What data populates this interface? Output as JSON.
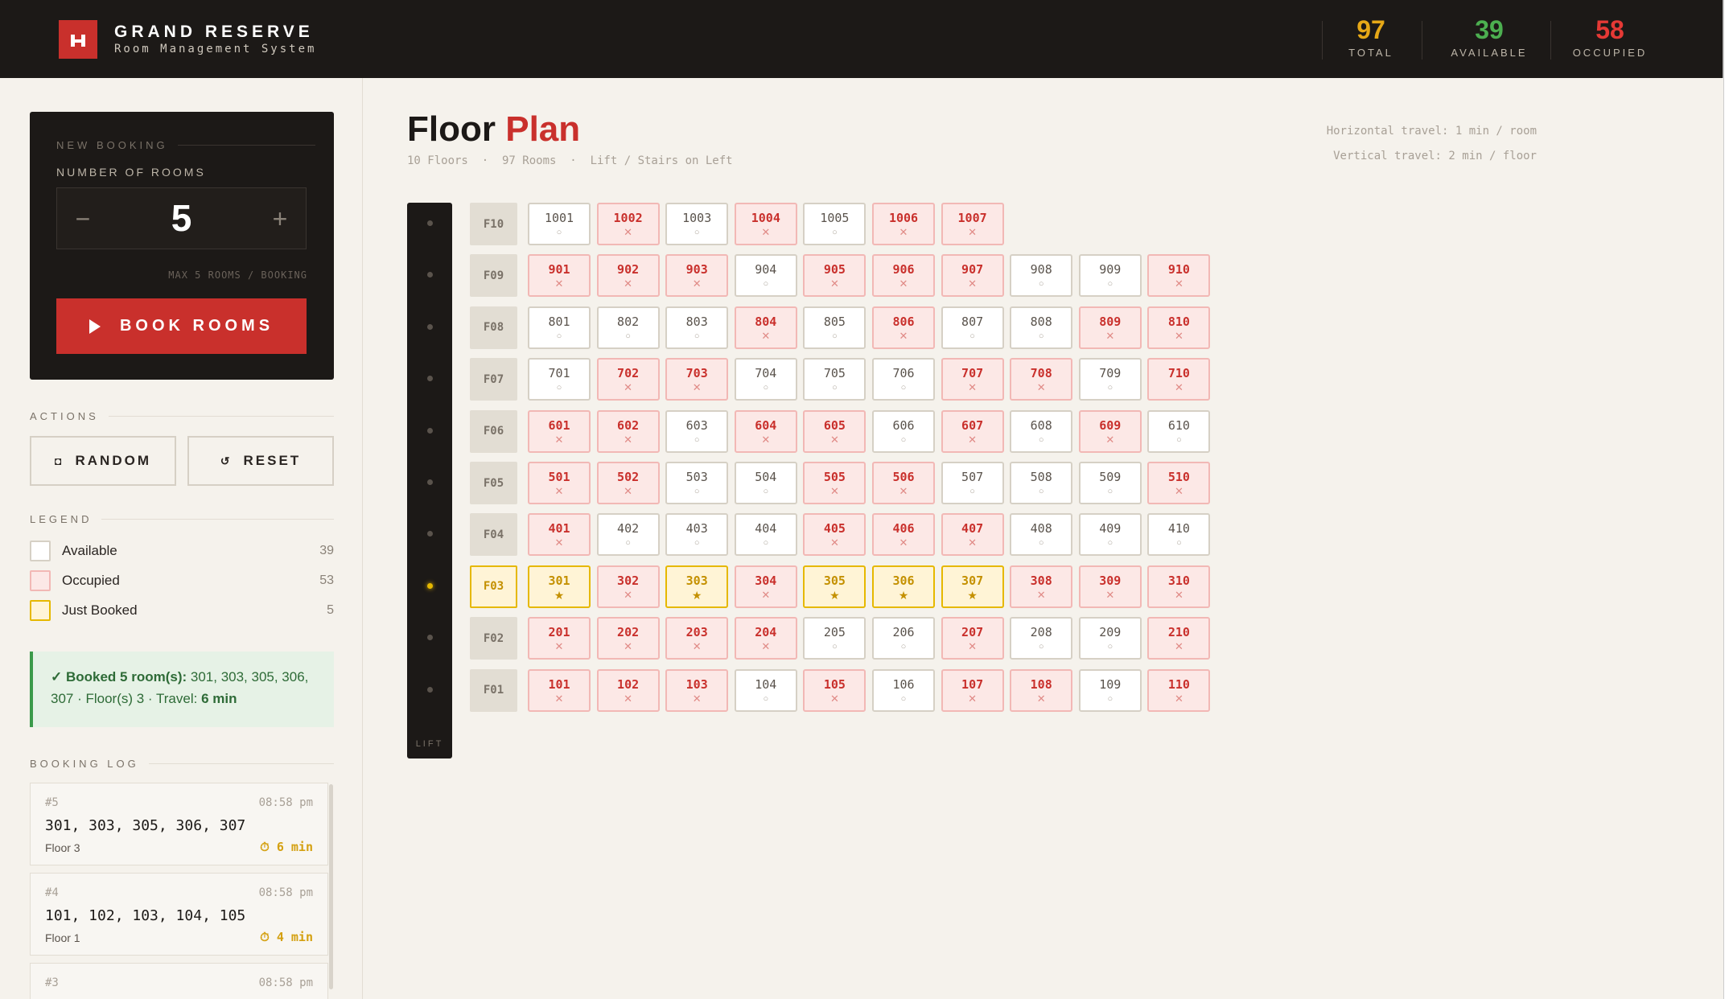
{
  "header": {
    "title": "GRAND RESERVE",
    "subtitle": "Room Management System",
    "stats": [
      {
        "value": "97",
        "label": "TOTAL",
        "color": "#e6a817"
      },
      {
        "value": "39",
        "label": "AVAILABLE",
        "color": "#4caf50"
      },
      {
        "value": "58",
        "label": "OCCUPIED",
        "color": "#e53935"
      }
    ]
  },
  "booking": {
    "section_label": "NEW BOOKING",
    "count_label": "NUMBER OF ROOMS",
    "minus": "−",
    "plus": "+",
    "count": "5",
    "max_note": "MAX 5 ROOMS / BOOKING",
    "book_label": "BOOK ROOMS"
  },
  "actions": {
    "label": "ACTIONS",
    "random_icon": "◘",
    "random": "RANDOM",
    "reset_icon": "↺",
    "reset": "RESET"
  },
  "legend": {
    "label": "LEGEND",
    "items": [
      {
        "name": "Available",
        "count": "39"
      },
      {
        "name": "Occupied",
        "count": "53"
      },
      {
        "name": "Just Booked",
        "count": "5"
      }
    ]
  },
  "result": {
    "head": "✓ Booked 5 room(s):",
    "rooms": " 301, 303, 305, 306, 307",
    "floor": " · Floor(s) 3 · Travel: ",
    "travel": "6 min"
  },
  "log": {
    "label": "BOOKING LOG",
    "entries": [
      {
        "id": "#5",
        "time": "08:58 pm",
        "rooms": "301, 303, 305, 306, 307",
        "floor": "Floor 3",
        "travel": "⏱ 6 min"
      },
      {
        "id": "#4",
        "time": "08:58 pm",
        "rooms": "101, 102, 103, 104, 105",
        "floor": "Floor 1",
        "travel": "⏱ 4 min"
      },
      {
        "id": "#3",
        "time": "08:58 pm",
        "rooms": "",
        "floor": "",
        "travel": ""
      }
    ]
  },
  "main": {
    "title_a": "Floor",
    "title_b": "Plan",
    "subtitle": "10 Floors  ·  97 Rooms  ·  Lift / Stairs on Left",
    "travel_h": "Horizontal travel: 1 min / room",
    "travel_v": "Vertical travel: 2 min / floor",
    "lift_label": "LIFT",
    "active_floor": "F03"
  },
  "floors": [
    {
      "label": "F10",
      "rooms": [
        [
          "1001",
          "a"
        ],
        [
          "1002",
          "o"
        ],
        [
          "1003",
          "a"
        ],
        [
          "1004",
          "o"
        ],
        [
          "1005",
          "a"
        ],
        [
          "1006",
          "o"
        ],
        [
          "1007",
          "o"
        ]
      ]
    },
    {
      "label": "F09",
      "rooms": [
        [
          "901",
          "o"
        ],
        [
          "902",
          "o"
        ],
        [
          "903",
          "o"
        ],
        [
          "904",
          "a"
        ],
        [
          "905",
          "o"
        ],
        [
          "906",
          "o"
        ],
        [
          "907",
          "o"
        ],
        [
          "908",
          "a"
        ],
        [
          "909",
          "a"
        ],
        [
          "910",
          "o"
        ]
      ]
    },
    {
      "label": "F08",
      "rooms": [
        [
          "801",
          "a"
        ],
        [
          "802",
          "a"
        ],
        [
          "803",
          "a"
        ],
        [
          "804",
          "o"
        ],
        [
          "805",
          "a"
        ],
        [
          "806",
          "o"
        ],
        [
          "807",
          "a"
        ],
        [
          "808",
          "a"
        ],
        [
          "809",
          "o"
        ],
        [
          "810",
          "o"
        ]
      ]
    },
    {
      "label": "F07",
      "rooms": [
        [
          "701",
          "a"
        ],
        [
          "702",
          "o"
        ],
        [
          "703",
          "o"
        ],
        [
          "704",
          "a"
        ],
        [
          "705",
          "a"
        ],
        [
          "706",
          "a"
        ],
        [
          "707",
          "o"
        ],
        [
          "708",
          "o"
        ],
        [
          "709",
          "a"
        ],
        [
          "710",
          "o"
        ]
      ]
    },
    {
      "label": "F06",
      "rooms": [
        [
          "601",
          "o"
        ],
        [
          "602",
          "o"
        ],
        [
          "603",
          "a"
        ],
        [
          "604",
          "o"
        ],
        [
          "605",
          "o"
        ],
        [
          "606",
          "a"
        ],
        [
          "607",
          "o"
        ],
        [
          "608",
          "a"
        ],
        [
          "609",
          "o"
        ],
        [
          "610",
          "a"
        ]
      ]
    },
    {
      "label": "F05",
      "rooms": [
        [
          "501",
          "o"
        ],
        [
          "502",
          "o"
        ],
        [
          "503",
          "a"
        ],
        [
          "504",
          "a"
        ],
        [
          "505",
          "o"
        ],
        [
          "506",
          "o"
        ],
        [
          "507",
          "a"
        ],
        [
          "508",
          "a"
        ],
        [
          "509",
          "a"
        ],
        [
          "510",
          "o"
        ]
      ]
    },
    {
      "label": "F04",
      "rooms": [
        [
          "401",
          "o"
        ],
        [
          "402",
          "a"
        ],
        [
          "403",
          "a"
        ],
        [
          "404",
          "a"
        ],
        [
          "405",
          "o"
        ],
        [
          "406",
          "o"
        ],
        [
          "407",
          "o"
        ],
        [
          "408",
          "a"
        ],
        [
          "409",
          "a"
        ],
        [
          "410",
          "a"
        ]
      ]
    },
    {
      "label": "F03",
      "rooms": [
        [
          "301",
          "b"
        ],
        [
          "302",
          "o"
        ],
        [
          "303",
          "b"
        ],
        [
          "304",
          "o"
        ],
        [
          "305",
          "b"
        ],
        [
          "306",
          "b"
        ],
        [
          "307",
          "b"
        ],
        [
          "308",
          "o"
        ],
        [
          "309",
          "o"
        ],
        [
          "310",
          "o"
        ]
      ]
    },
    {
      "label": "F02",
      "rooms": [
        [
          "201",
          "o"
        ],
        [
          "202",
          "o"
        ],
        [
          "203",
          "o"
        ],
        [
          "204",
          "o"
        ],
        [
          "205",
          "a"
        ],
        [
          "206",
          "a"
        ],
        [
          "207",
          "o"
        ],
        [
          "208",
          "a"
        ],
        [
          "209",
          "a"
        ],
        [
          "210",
          "o"
        ]
      ]
    },
    {
      "label": "F01",
      "rooms": [
        [
          "101",
          "o"
        ],
        [
          "102",
          "o"
        ],
        [
          "103",
          "o"
        ],
        [
          "104",
          "a"
        ],
        [
          "105",
          "o"
        ],
        [
          "106",
          "a"
        ],
        [
          "107",
          "o"
        ],
        [
          "108",
          "o"
        ],
        [
          "109",
          "a"
        ],
        [
          "110",
          "o"
        ]
      ]
    }
  ],
  "symbols": {
    "available": "○",
    "occupied": "✕",
    "booked": "★"
  },
  "colors": {
    "accent": "#c9302c",
    "booked": "#e6b800",
    "available_stat": "#4caf50"
  }
}
